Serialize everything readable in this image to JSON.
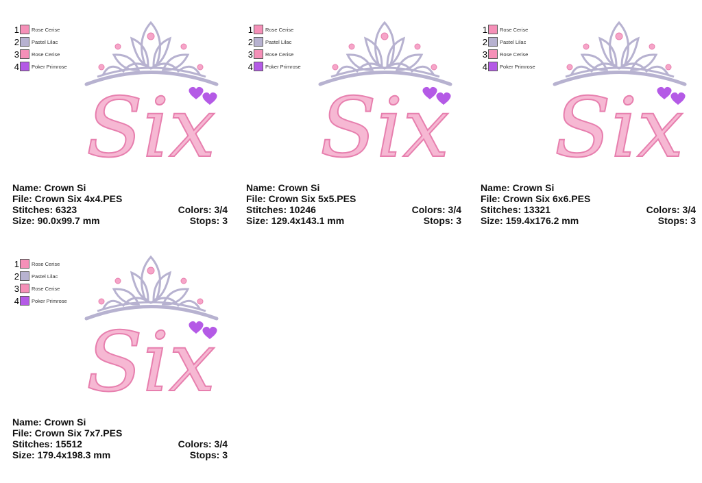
{
  "legend_colors": {
    "rose_cerise": "#f590b8",
    "pastel_lilac": "#b7b2d0",
    "poker_primrose": "#b45ae6"
  },
  "designs": [
    {
      "legend": [
        {
          "num": "1",
          "name": "Rose Cerise"
        },
        {
          "num": "2",
          "name": "Pastel Lilac"
        },
        {
          "num": "3",
          "name": "Rose Cerise"
        },
        {
          "num": "4",
          "name": "Poker Primrose"
        }
      ],
      "word": "Six",
      "name": "Name: Crown Si",
      "file": "File: Crown Six 4x4.PES",
      "stitches": "Stitches: 6323",
      "colors": "Colors: 3/4",
      "size": "Size: 90.0x99.7 mm",
      "stops": "Stops: 3"
    },
    {
      "legend": [
        {
          "num": "1",
          "name": "Rose Cerise"
        },
        {
          "num": "2",
          "name": "Pastel Lilac"
        },
        {
          "num": "3",
          "name": "Rose Cerise"
        },
        {
          "num": "4",
          "name": "Poker Primrose"
        }
      ],
      "word": "Six",
      "name": "Name: Crown Si",
      "file": "File: Crown Six 5x5.PES",
      "stitches": "Stitches: 10246",
      "colors": "Colors: 3/4",
      "size": "Size: 129.4x143.1 mm",
      "stops": "Stops: 3"
    },
    {
      "legend": [
        {
          "num": "1",
          "name": "Rose Cerise"
        },
        {
          "num": "2",
          "name": "Pastel Lilac"
        },
        {
          "num": "3",
          "name": "Rose Cerise"
        },
        {
          "num": "4",
          "name": "Poker Primrose"
        }
      ],
      "word": "Six",
      "name": "Name: Crown Si",
      "file": "File: Crown Six 6x6.PES",
      "stitches": "Stitches: 13321",
      "colors": "Colors: 3/4",
      "size": "Size: 159.4x176.2 mm",
      "stops": "Stops: 3"
    },
    {
      "legend": [
        {
          "num": "1",
          "name": "Rose Cerise"
        },
        {
          "num": "2",
          "name": "Pastel Lilac"
        },
        {
          "num": "3",
          "name": "Rose Cerise"
        },
        {
          "num": "4",
          "name": "Poker Primrose"
        }
      ],
      "word": "Six",
      "name": "Name: Crown Si",
      "file": "File: Crown Six 7x7.PES",
      "stitches": "Stitches: 15512",
      "colors": "Colors: 3/4",
      "size": "Size: 179.4x198.3 mm",
      "stops": "Stops: 3"
    }
  ]
}
